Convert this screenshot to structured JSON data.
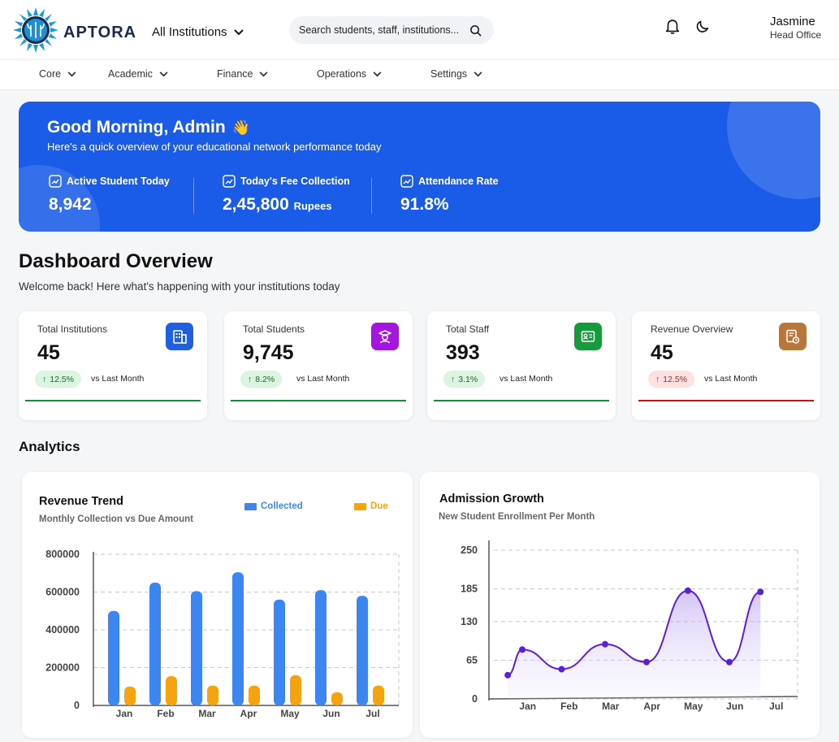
{
  "header": {
    "brand": "APTORA",
    "institution_select": "All Institutions",
    "search_placeholder": "Search students, staff, institutions...",
    "user_name": "Jasmine",
    "user_role": "Head Office"
  },
  "nav": {
    "items": [
      {
        "label": "Core"
      },
      {
        "label": "Academic"
      },
      {
        "label": "Finance"
      },
      {
        "label": "Operations"
      },
      {
        "label": "Settings"
      }
    ]
  },
  "hero": {
    "greeting": "Good Morning, Admin",
    "emoji": "👋",
    "subtitle": "Here's a quick overview of your educational network performance today",
    "stats": [
      {
        "label": "Active Student Today",
        "value": "8,942",
        "unit": ""
      },
      {
        "label": "Today's Fee Collection",
        "value": "2,45,800",
        "unit": "Rupees"
      },
      {
        "label": "Attendance Rate",
        "value": "91.8%",
        "unit": ""
      }
    ]
  },
  "overview": {
    "title": "Dashboard Overview",
    "subtitle": "Welcome back! Here what's happening with your institutions today"
  },
  "cards": [
    {
      "label": "Total Institutions",
      "value": "45",
      "change": "12.5%",
      "trend": "up",
      "vs": "vs Last Month",
      "icon": "building-icon",
      "icon_color": "#1f5fe0",
      "line_color": "#1a8a3a"
    },
    {
      "label": "Total Students",
      "value": "9,745",
      "change": "8.2%",
      "trend": "up",
      "vs": "vs Last Month",
      "icon": "graduate-icon",
      "icon_color": "#a415e0",
      "line_color": "#1a8a3a"
    },
    {
      "label": "Total Staff",
      "value": "393",
      "change": "3.1%",
      "trend": "up",
      "vs": "vs Last Month",
      "icon": "id-card-icon",
      "icon_color": "#169a3c",
      "line_color": "#1a8a3a"
    },
    {
      "label": "Revenue Overview",
      "value": "45",
      "change": "12.5%",
      "trend": "down",
      "vs": "vs Last Month",
      "icon": "report-icon",
      "icon_color": "#b8763a",
      "line_color": "#c0141b"
    }
  ],
  "analytics": {
    "title": "Analytics"
  },
  "colors": {
    "primary": "#1a5ce8",
    "collected": "#3b86f0",
    "due": "#f5a30f",
    "growth": "#5a1fd6"
  },
  "chart_data": [
    {
      "type": "bar",
      "title": "Revenue Trend",
      "subtitle": "Monthly Collection vs Due Amount",
      "categories": [
        "Jan",
        "Feb",
        "Mar",
        "Apr",
        "May",
        "Jun",
        "Jul"
      ],
      "series": [
        {
          "name": "Collected",
          "values": [
            500000,
            650000,
            605000,
            705000,
            560000,
            610000,
            580000
          ]
        },
        {
          "name": "Due",
          "values": [
            100000,
            155000,
            105000,
            105000,
            160000,
            70000,
            105000
          ]
        }
      ],
      "yticks": [
        "0",
        "200000",
        "400000",
        "600000",
        "800000"
      ],
      "ylim": [
        0,
        800000
      ],
      "legend": "top-right",
      "grid": true
    },
    {
      "type": "area",
      "title": "Admission Growth",
      "subtitle": "New Student Enrollment Per Month",
      "categories": [
        "Jan",
        "Feb",
        "Mar",
        "Apr",
        "May",
        "Jun",
        "Jul"
      ],
      "series": [
        {
          "values": [
            40,
            83,
            50,
            92,
            62,
            182,
            62,
            180
          ]
        }
      ],
      "x_positions": [
        -0.35,
        0,
        0.95,
        2.0,
        3.0,
        4.0,
        5.0,
        5.75
      ],
      "yticks": [
        "0",
        "65",
        "130",
        "185",
        "250"
      ],
      "ylim": [
        0,
        250
      ],
      "grid": true
    }
  ]
}
